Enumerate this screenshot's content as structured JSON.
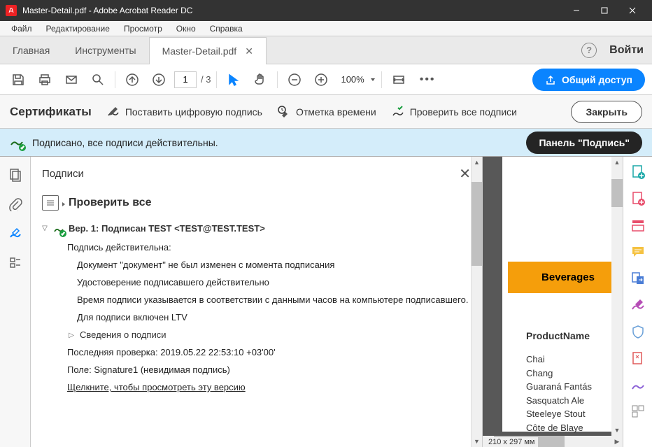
{
  "titlebar": {
    "title": "Master-Detail.pdf - Adobe Acrobat Reader DC"
  },
  "menubar": {
    "items": [
      "Файл",
      "Редактирование",
      "Просмотр",
      "Окно",
      "Справка"
    ]
  },
  "tabs": {
    "home": "Главная",
    "tools": "Инструменты",
    "active": "Master-Detail.pdf",
    "login": "Войти"
  },
  "toolbar": {
    "page_current": "1",
    "page_total": "/ 3",
    "zoom": "100%",
    "share": "Общий доступ"
  },
  "certbar": {
    "title": "Сертификаты",
    "sign": "Поставить цифровую подпись",
    "timestamp": "Отметка времени",
    "verify_all": "Проверить все подписи",
    "close": "Закрыть"
  },
  "sigstatus": {
    "text": "Подписано, все подписи действительны.",
    "panel_btn": "Панель \"Подпись\""
  },
  "sigpanel": {
    "title": "Подписи",
    "verify_all": "Проверить все",
    "rev_label": "Вер. 1: Подписан TEST <TEST@TEST.TEST>",
    "valid": "Подпись действительна:",
    "line1": "Документ \"документ\" не был изменен с момента подписания",
    "line2": "Удостоверение подписавшего действительно",
    "line3": "Время подписи указывается в соответствии с данными часов на компьютере подписавшего.",
    "line4": "Для подписи включен LTV",
    "details": "Сведения о подписи",
    "last_check": "Последняя проверка: 2019.05.22 22:53:10 +03'00'",
    "field": "Поле: Signature1 (невидимая подпись)",
    "view_version": "Щелкните, чтобы просмотреть эту версию"
  },
  "preview": {
    "category": "Beverages",
    "col_header": "ProductName",
    "items": [
      "Chai",
      "Chang",
      "Guaraná Fantás",
      "Sasquatch Ale",
      "Steeleye Stout",
      "Côte de Blaye"
    ],
    "dims": "210 x 297 мм"
  }
}
